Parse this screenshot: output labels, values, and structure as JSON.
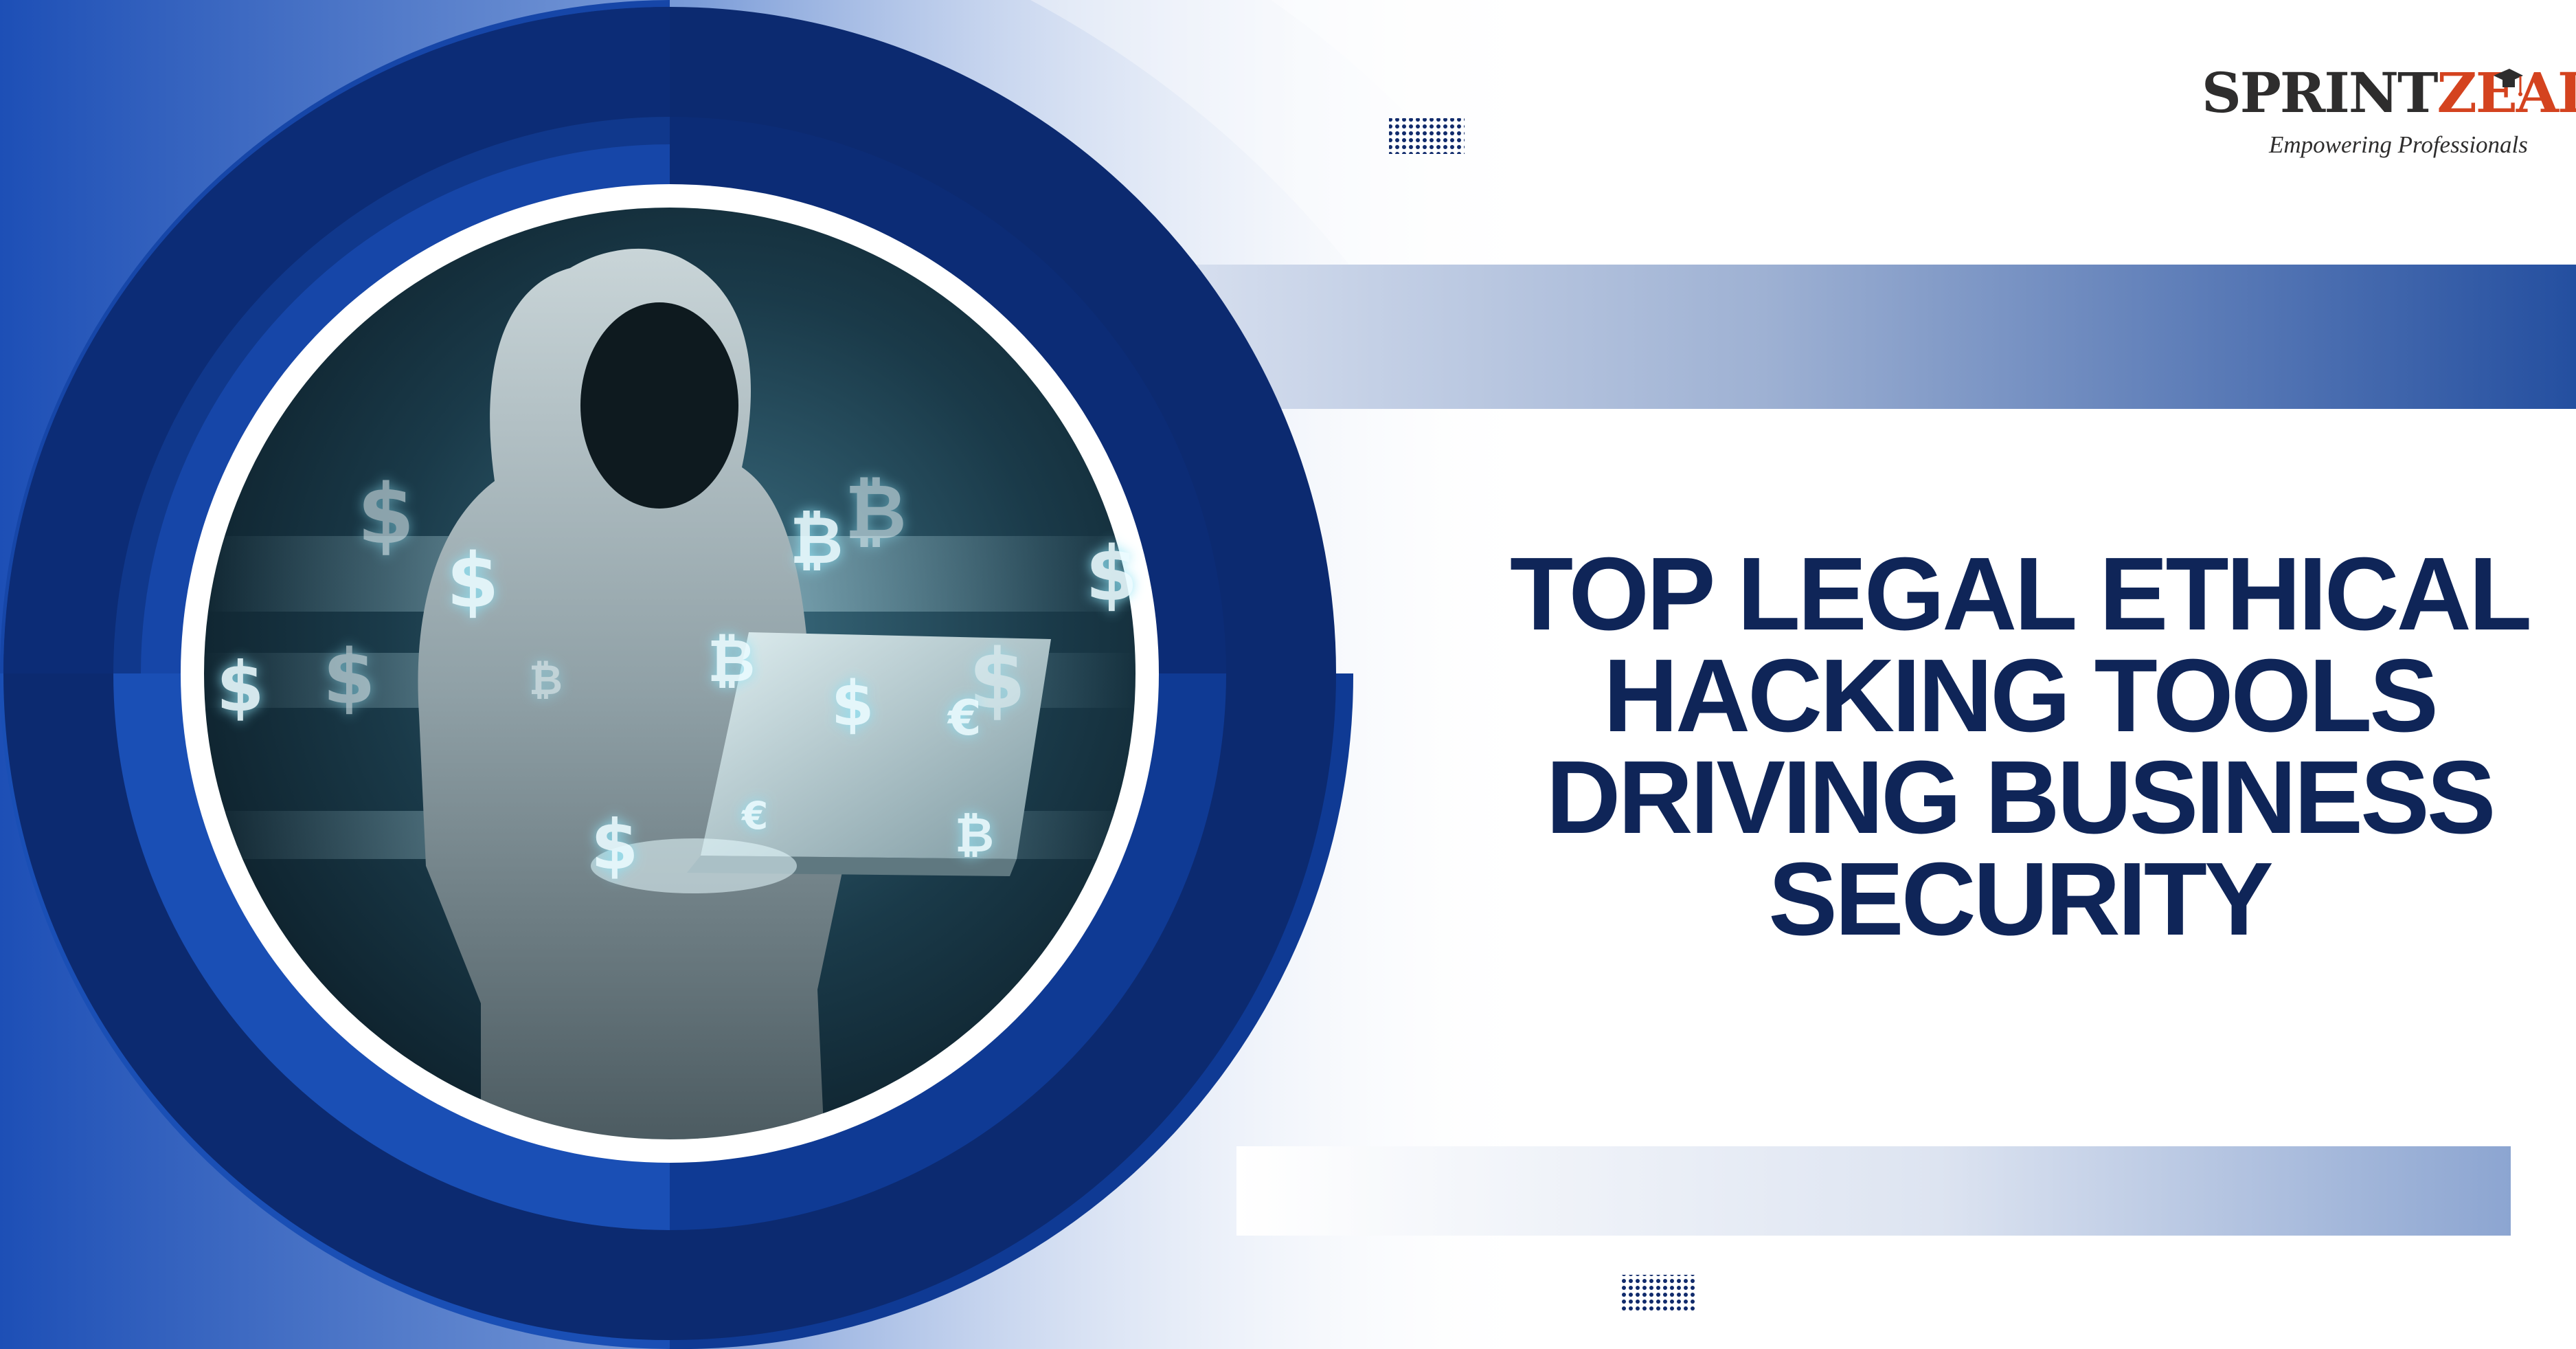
{
  "brand": {
    "name_dark": "SPRINT",
    "name_accent": "ZEAL",
    "tagline": "Empowering Professionals"
  },
  "headline": {
    "lines": [
      "TOP LEGAL ETHICAL",
      "HACKING TOOLS",
      "DRIVING BUSINESS",
      "SECURITY"
    ]
  },
  "colors": {
    "navy": "#0d2a6b",
    "royal_blue": "#1e4fb8",
    "headline": "#0f2558",
    "brand_accent": "#d4431f"
  },
  "icons": {
    "logo_mark": "graduation-cap-icon",
    "photo": "hooded-hacker-with-laptop-and-currency-symbols"
  },
  "floating_symbols": [
    "$",
    "$",
    "$",
    "$",
    "$",
    "$",
    "$",
    "$",
    "₿",
    "₿",
    "₿",
    "₿",
    "₿",
    "€",
    "€"
  ]
}
